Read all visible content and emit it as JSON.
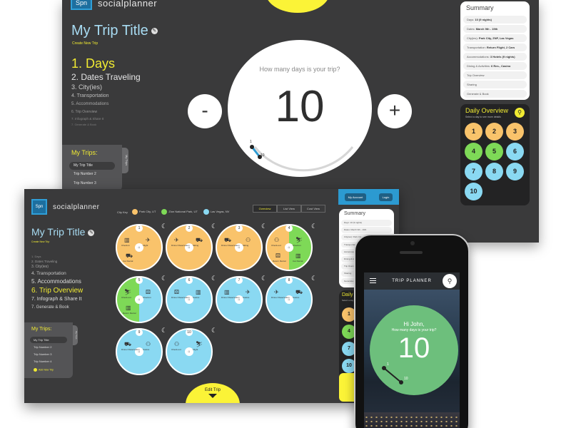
{
  "screen1": {
    "logo_mark": "Spn",
    "logo_text": "socialplanner",
    "trip_title": "My Trip Title",
    "create_link": "Create New Trip",
    "steps": [
      "1. Days",
      "2. Dates Traveling",
      "3. City(ies)",
      "4. Transportation",
      "5. Accommodations",
      "6. Trip Overview",
      "7. Infograph & Share It",
      "7. Generate & Book"
    ],
    "counter_question": "How many days is your trip?",
    "counter_value": "10",
    "minus_label": "-",
    "plus_label": "+",
    "dial_min": "1",
    "dial_max": "10",
    "my_trips": {
      "title": "My Trips:",
      "tab": "My Trips",
      "items": [
        "My Trip Title",
        "Trip Number 2",
        "Trip Number 3"
      ]
    },
    "summary": {
      "title": "Summary",
      "rows": [
        {
          "label": "Days:",
          "value": "10 (9 nights)"
        },
        {
          "label": "Dates:",
          "value": "March 9th - 19th"
        },
        {
          "label": "City(ies):",
          "value": "Park City, ZNP, Las Vegas"
        },
        {
          "label": "Transportation:",
          "value": "Return Flight, 2 Cars"
        },
        {
          "label": "Accommodations:",
          "value": "3 Hotels (9 nights)"
        },
        {
          "label": "Dining & Activities:",
          "value": "6 Res., Casino"
        }
      ],
      "links": [
        "Trip Overview",
        "Sharing",
        "Generate & Book"
      ]
    },
    "daily": {
      "title": "Daily Overview",
      "subtitle": "Select a day to see more details",
      "days": [
        {
          "n": "1",
          "color": "#f9c36b"
        },
        {
          "n": "2",
          "color": "#f9c36b"
        },
        {
          "n": "3",
          "color": "#f9c36b"
        },
        {
          "n": "4",
          "color": "#7ed957"
        },
        {
          "n": "5",
          "color": "#7ed957"
        },
        {
          "n": "6",
          "color": "#8ad9f2"
        },
        {
          "n": "7",
          "color": "#8ad9f2"
        },
        {
          "n": "8",
          "color": "#8ad9f2"
        },
        {
          "n": "9",
          "color": "#8ad9f2"
        },
        {
          "n": "10",
          "color": "#8ad9f2"
        }
      ]
    }
  },
  "screen2": {
    "logo_mark": "Spn",
    "logo_text": "socialplanner",
    "city_key_label": "City Key",
    "cities": [
      {
        "name": "Park City, UT",
        "color": "#f9c36b"
      },
      {
        "name": "Zion National Park, UT",
        "color": "#7ed957"
      },
      {
        "name": "Las Vegas, NV",
        "color": "#8ad9f2"
      }
    ],
    "view_tabs": [
      "Overview",
      "List View",
      "Cost View"
    ],
    "account": {
      "my_account": "My Account",
      "login": "Login"
    },
    "trip_title": "My Trip Title",
    "create_link": "Create New Trip",
    "steps": [
      "1. Days",
      "2. Dates Traveling",
      "3. City(ies)",
      "4. Transportation",
      "5. Accommodations",
      "6. Trip Overview",
      "7. Infograph & Share It",
      "7. Generate & Book"
    ],
    "my_trips": {
      "title": "My Trips:",
      "tab": "My Trips",
      "items": [
        "My Trip Title",
        "Trip Number 2",
        "Trip Number 3",
        "Trip Number 4"
      ],
      "add": "Add New Trip"
    },
    "summary": {
      "title": "Summary",
      "rows": [
        "Days: 10 (9 nights)",
        "Dates: March 9th - 19th",
        "City(ies): Park City, ZNP",
        "Transportation",
        "Accommodations",
        "Dining & Activities",
        "Trip Overview",
        "Sharing",
        "Generate & Book"
      ]
    },
    "daily_label": "Daily",
    "daily_sub": "Select a day",
    "daily_days": [
      {
        "n": "1",
        "color": "#f9c36b"
      },
      {
        "n": "4",
        "color": "#7ed957"
      },
      {
        "n": "7",
        "color": "#8ad9f2"
      },
      {
        "n": "10",
        "color": "#8ad9f2"
      }
    ],
    "wheels": [
      {
        "n": "1",
        "color": "#f9c36b",
        "labels": [
          "Check-in",
          "Flight",
          "Car Rental"
        ]
      },
      {
        "n": "2",
        "color": "#f9c36b",
        "labels": [
          "Dinner Reservation",
          "Skiing"
        ]
      },
      {
        "n": "3",
        "color": "#f9c36b",
        "labels": [
          "Dinner Reservation",
          "Skiing"
        ]
      },
      {
        "n": "4",
        "color": "#f9c36b",
        "split": "#7ed957",
        "labels": [
          "Check-out",
          "Check-in",
          "Return Rental",
          "Car Rental"
        ]
      },
      {
        "n": "5",
        "color": "#7ed957",
        "split": "#8ad9f2",
        "labels": [
          "Check-out",
          "Check-in",
          "Return Rental"
        ]
      },
      {
        "n": "6",
        "color": "#8ad9f2",
        "labels": [
          "Dinner Reservation",
          "Casino"
        ]
      },
      {
        "n": "7",
        "color": "#8ad9f2",
        "labels": [
          "Dinner Reservation",
          "Casino"
        ]
      },
      {
        "n": "8",
        "color": "#8ad9f2",
        "labels": [
          "Dinner Reservation",
          "Casino"
        ]
      },
      {
        "n": "9",
        "color": "#8ad9f2",
        "labels": [
          "Dinner Reservation",
          "Casino"
        ]
      },
      {
        "n": "10",
        "color": "#8ad9f2",
        "labels": [
          "Check-out",
          "Flight"
        ]
      }
    ],
    "edit_trip": "Edit Trip"
  },
  "phone": {
    "app_title": "TRIP PLANNER",
    "greeting": "Hi John,",
    "question": "How many days is your trip?",
    "value": "10",
    "dial_min": "1",
    "dial_max": "10"
  }
}
